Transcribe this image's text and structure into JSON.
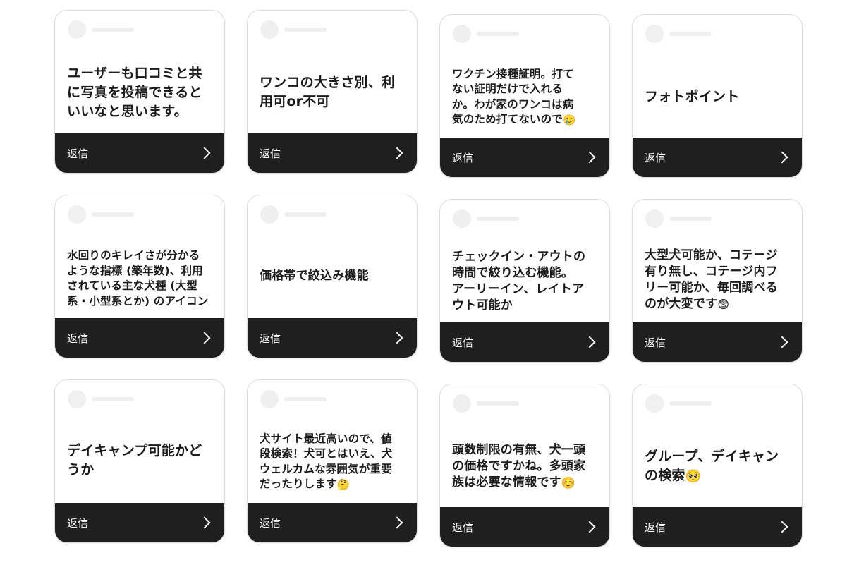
{
  "reply_label": "返信",
  "cards": [
    {
      "lines": [
        "ユーザーも口コミと共",
        "に写真を投稿できると",
        "いいなと思います。"
      ],
      "emoji": ""
    },
    {
      "lines": [
        "ワンコの大きさ別、利",
        "用可or不可"
      ],
      "emoji": ""
    },
    {
      "lines": [
        "ワクチン接種証明。打て",
        "ない証明だけで入れる",
        "か。わが家のワンコは病",
        "気のため打てないので"
      ],
      "emoji": "🥲"
    },
    {
      "lines": [
        "フォトポイント"
      ],
      "emoji": ""
    },
    {
      "lines": [
        "水回りのキレイさが分かる",
        "ような指標 (築年数)、利用",
        "されている主な犬種 (大型",
        "系・小型系とか) のアイコン"
      ],
      "emoji": ""
    },
    {
      "lines": [
        "価格帯で絞込み機能"
      ],
      "emoji": ""
    },
    {
      "lines": [
        "チェックイン・アウトの",
        "時間で絞り込む機能。",
        "アーリーイン、レイトア",
        "ウト可能か"
      ],
      "emoji": ""
    },
    {
      "lines": [
        "大型犬可能か、コテージ",
        "有り無し、コテージ内フ",
        "リー可能か、毎回調べる",
        "のが大変です"
      ],
      "emoji": "😨"
    },
    {
      "lines": [
        "デイキャンプ可能かど",
        "うか"
      ],
      "emoji": ""
    },
    {
      "lines": [
        "犬サイト最近高いので、値",
        "段検索！犬可とはいえ、犬",
        "ウェルカムな雰囲気が重要",
        "だったりします"
      ],
      "emoji": "🤔"
    },
    {
      "lines": [
        "頭数制限の有無、犬一頭",
        "の価格ですかね。多頭家",
        "族は必要な情報です"
      ],
      "emoji": "☺️"
    },
    {
      "lines": [
        "グループ、デイキャン",
        "の検索"
      ],
      "emoji": "🥺"
    }
  ]
}
